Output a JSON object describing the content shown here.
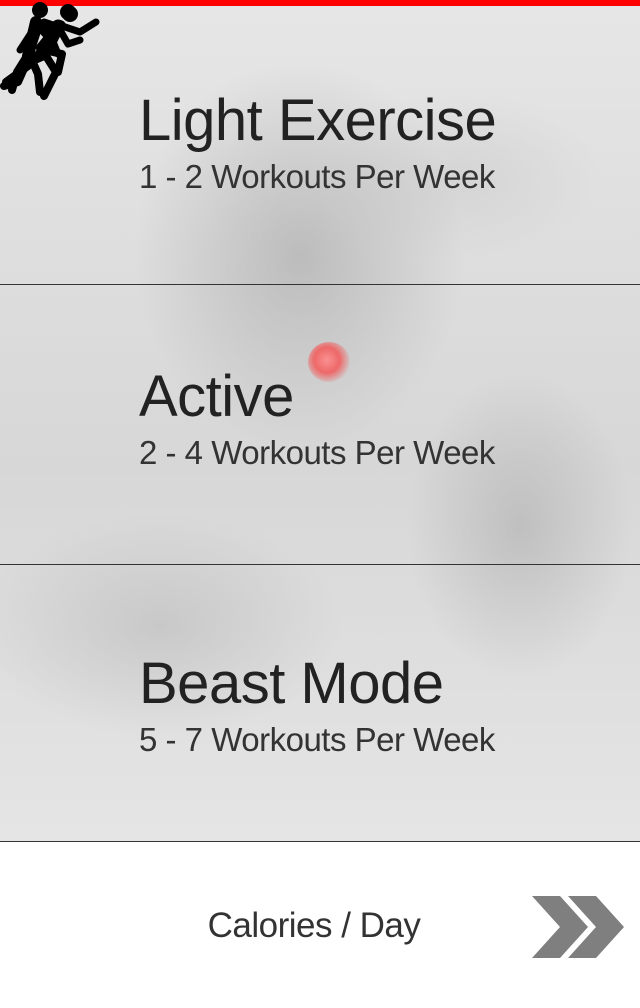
{
  "colors": {
    "accent_bar": "#ff0000",
    "title_text": "#222222",
    "subtitle_text": "#333333",
    "divider": "#333333",
    "next_arrow": "#7f7f7f"
  },
  "options": [
    {
      "icon": "walking-person-icon",
      "title": "Light Exercise",
      "subtitle": "1 - 2 Workouts Per Week"
    },
    {
      "icon": "jogging-person-icon",
      "title": "Active",
      "subtitle": "2 - 4 Workouts Per Week"
    },
    {
      "icon": "sprinting-person-icon",
      "title": "Beast Mode",
      "subtitle": "5 - 7 Workouts Per Week"
    }
  ],
  "footer": {
    "label": "Calories / Day",
    "next_icon": "double-chevron-right-icon"
  }
}
